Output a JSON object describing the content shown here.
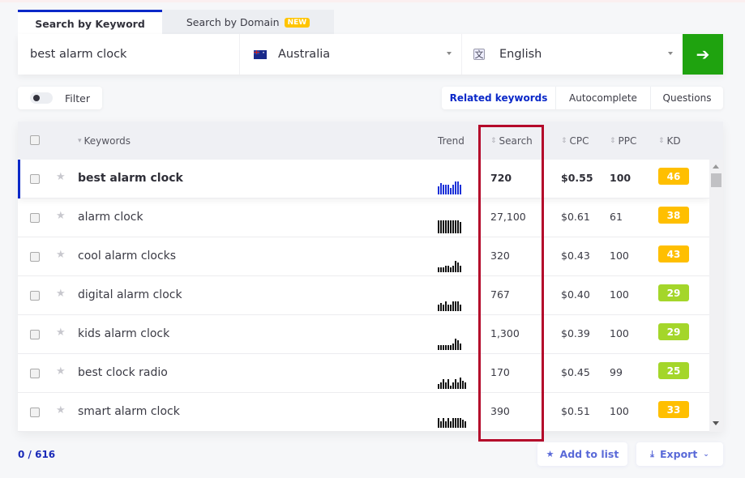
{
  "tabs": [
    {
      "label": "Search by Keyword",
      "active": true
    },
    {
      "label": "Search by Domain",
      "badge": "NEW",
      "active": false
    }
  ],
  "search": {
    "keyword_value": "best alarm clock",
    "country": "Australia",
    "country_icon": "australia-flag-icon",
    "language": "English",
    "language_icon": "translate-icon",
    "go_icon": "arrow-right-icon",
    "go_color": "#1fa30f"
  },
  "filter": {
    "label": "Filter",
    "enabled": false
  },
  "modes": [
    {
      "label": "Related keywords",
      "active": true
    },
    {
      "label": "Autocomplete",
      "active": false
    },
    {
      "label": "Questions",
      "active": false
    }
  ],
  "table": {
    "columns": {
      "keywords": "Keywords",
      "trend": "Trend",
      "search": "Search",
      "cpc": "CPC",
      "ppc": "PPC",
      "kd": "KD"
    },
    "rows": [
      {
        "keyword": "best alarm clock",
        "search": "720",
        "cpc": "$0.55",
        "ppc": "100",
        "kd": "46",
        "kd_color": "#ffbf00",
        "trend": [
          5,
          7,
          6,
          6,
          6,
          4,
          6,
          8,
          8,
          6
        ]
      },
      {
        "keyword": "alarm clock",
        "search": "27,100",
        "cpc": "$0.61",
        "ppc": "61",
        "kd": "38",
        "kd_color": "#ffbf00",
        "trend": [
          8,
          8,
          8,
          8,
          8,
          8,
          8,
          8,
          8,
          7
        ]
      },
      {
        "keyword": "cool alarm clocks",
        "search": "320",
        "cpc": "$0.43",
        "ppc": "100",
        "kd": "43",
        "kd_color": "#ffbf00",
        "trend": [
          3,
          3,
          3,
          4,
          4,
          3,
          4,
          7,
          6,
          4
        ]
      },
      {
        "keyword": "digital alarm clock",
        "search": "767",
        "cpc": "$0.40",
        "ppc": "100",
        "kd": "29",
        "kd_color": "#a4d62a",
        "trend": [
          4,
          5,
          4,
          6,
          4,
          4,
          6,
          6,
          6,
          4
        ]
      },
      {
        "keyword": "kids alarm clock",
        "search": "1,300",
        "cpc": "$0.39",
        "ppc": "100",
        "kd": "29",
        "kd_color": "#a4d62a",
        "trend": [
          3,
          3,
          3,
          3,
          3,
          3,
          4,
          7,
          6,
          4
        ]
      },
      {
        "keyword": "best clock radio",
        "search": "170",
        "cpc": "$0.45",
        "ppc": "99",
        "kd": "25",
        "kd_color": "#a4d62a",
        "trend": [
          3,
          4,
          6,
          4,
          6,
          2,
          4,
          6,
          4,
          7,
          5,
          4
        ]
      },
      {
        "keyword": "smart alarm clock",
        "search": "390",
        "cpc": "$0.51",
        "ppc": "100",
        "kd": "33",
        "kd_color": "#ffbf00",
        "trend": [
          6,
          4,
          6,
          4,
          6,
          4,
          6,
          6,
          6,
          6,
          5,
          4
        ]
      }
    ]
  },
  "footer": {
    "count": "0 / 616",
    "add_to_list": "Add to list",
    "export": "Export"
  }
}
